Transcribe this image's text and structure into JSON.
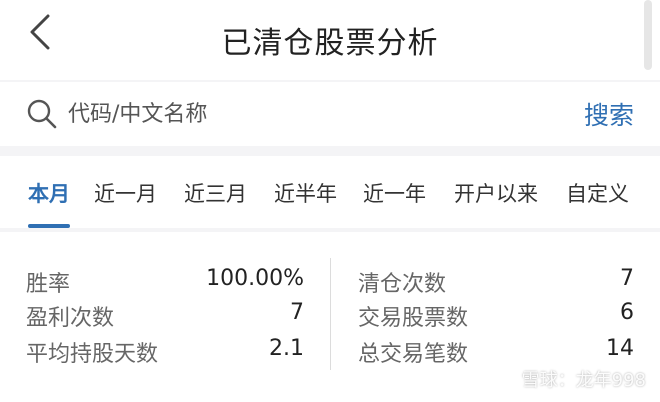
{
  "header": {
    "title": "已清仓股票分析"
  },
  "search": {
    "placeholder": "代码/中文名称",
    "button_label": "搜索"
  },
  "tabs": [
    {
      "label": "本月",
      "active": true
    },
    {
      "label": "近一月",
      "active": false
    },
    {
      "label": "近三月",
      "active": false
    },
    {
      "label": "近半年",
      "active": false
    },
    {
      "label": "近一年",
      "active": false
    },
    {
      "label": "开户以来",
      "active": false
    },
    {
      "label": "自定义",
      "active": false
    }
  ],
  "stats": {
    "left": [
      {
        "label": "胜率",
        "value": "100.00%"
      },
      {
        "label": "盈利次数",
        "value": "7"
      },
      {
        "label": "平均持股天数",
        "value": "2.1"
      }
    ],
    "right": [
      {
        "label": "清仓次数",
        "value": "7"
      },
      {
        "label": "交易股票数",
        "value": "6"
      },
      {
        "label": "总交易笔数",
        "value": "14"
      }
    ]
  },
  "watermark": {
    "text": "雪球：龙年998"
  },
  "colors": {
    "accent": "#2f6fb3",
    "background": "#f4f4f6",
    "card": "#ffffff"
  }
}
